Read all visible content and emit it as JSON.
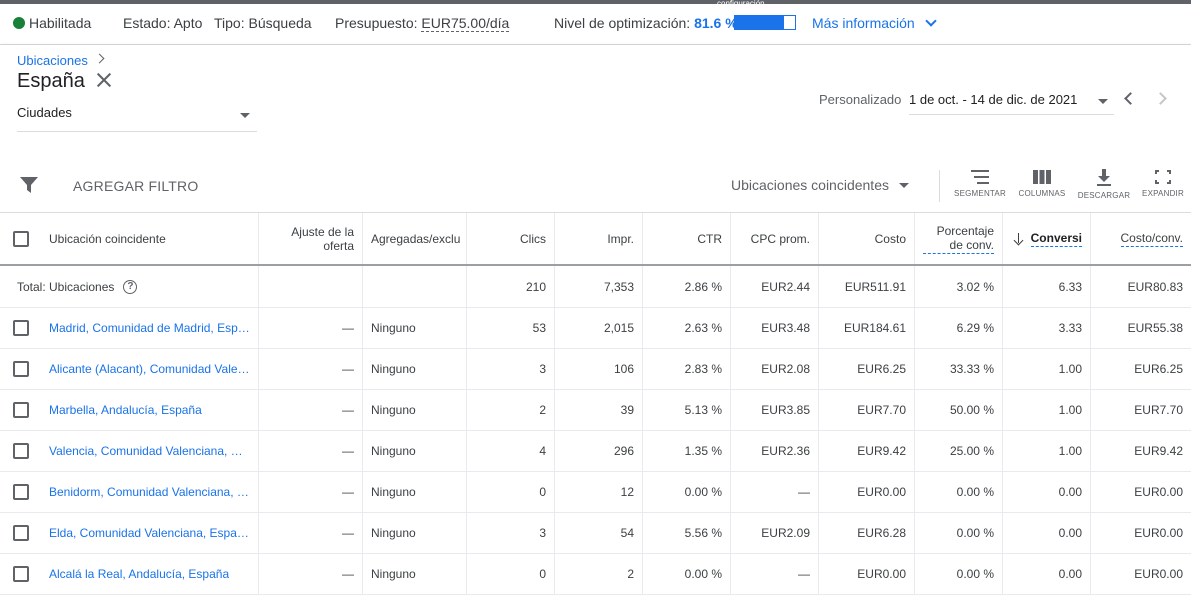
{
  "status_bar": {
    "status": "Habilitada",
    "estado": "Estado: Apto",
    "tipo": "Tipo: Búsqueda",
    "presupuesto_label": "Presupuesto:",
    "presupuesto_value": "EUR75.00/día",
    "optimization_label": "Nivel de optimización:",
    "optimization_value": "81.6 %",
    "optimization_fraction": 0.816,
    "more_info": "Más información",
    "tiny_label": "configuración",
    "status_color": "#188038",
    "accent_color": "#1a73e8"
  },
  "header": {
    "breadcrumb": "Ubicaciones",
    "title": "España",
    "city_select": "Ciudades",
    "date_label": "Personalizado",
    "date_range": "1 de oct. - 14 de dic. de 2021"
  },
  "toolbar": {
    "add_filter": "AGREGAR FILTRO",
    "match_select": "Ubicaciones coincidentes",
    "segment": "SEGMENTAR",
    "columns": "COLUMNAS",
    "download": "DESCARGAR",
    "expand": "EXPANDIR"
  },
  "table": {
    "columns": {
      "location": "Ubicación coincidente",
      "bid_adj": "Ajuste de la oferta",
      "added": "Agregadas/exclu",
      "clicks": "Clics",
      "impr": "Impr.",
      "ctr": "CTR",
      "cpc": "CPC prom.",
      "cost": "Costo",
      "conv_rate": "Porcentaje de conv.",
      "conversions": "Conversi",
      "cost_conv": "Costo/conv."
    },
    "total": {
      "label": "Total: Ubicaciones",
      "clicks": "210",
      "impr": "7,353",
      "ctr": "2.86 %",
      "cpc": "EUR2.44",
      "cost": "EUR511.91",
      "conv_rate": "3.02 %",
      "conversions": "6.33",
      "cost_conv": "EUR80.83"
    },
    "rows": [
      {
        "location": "Madrid, Comunidad de Madrid, Espa…",
        "bid_adj": "—",
        "added": "Ninguno",
        "clicks": "53",
        "impr": "2,015",
        "ctr": "2.63 %",
        "cpc": "EUR3.48",
        "cost": "EUR184.61",
        "conv_rate": "6.29 %",
        "conversions": "3.33",
        "cost_conv": "EUR55.38"
      },
      {
        "location": "Alicante (Alacant), Comunidad Vale…",
        "bid_adj": "—",
        "added": "Ninguno",
        "clicks": "3",
        "impr": "106",
        "ctr": "2.83 %",
        "cpc": "EUR2.08",
        "cost": "EUR6.25",
        "conv_rate": "33.33 %",
        "conversions": "1.00",
        "cost_conv": "EUR6.25"
      },
      {
        "location": "Marbella, Andalucía, España",
        "bid_adj": "—",
        "added": "Ninguno",
        "clicks": "2",
        "impr": "39",
        "ctr": "5.13 %",
        "cpc": "EUR3.85",
        "cost": "EUR7.70",
        "conv_rate": "50.00 %",
        "conversions": "1.00",
        "cost_conv": "EUR7.70"
      },
      {
        "location": "Valencia, Comunidad Valenciana, Es…",
        "bid_adj": "—",
        "added": "Ninguno",
        "clicks": "4",
        "impr": "296",
        "ctr": "1.35 %",
        "cpc": "EUR2.36",
        "cost": "EUR9.42",
        "conv_rate": "25.00 %",
        "conversions": "1.00",
        "cost_conv": "EUR9.42"
      },
      {
        "location": "Benidorm, Comunidad Valenciana, E…",
        "bid_adj": "—",
        "added": "Ninguno",
        "clicks": "0",
        "impr": "12",
        "ctr": "0.00 %",
        "cpc": "—",
        "cost": "EUR0.00",
        "conv_rate": "0.00 %",
        "conversions": "0.00",
        "cost_conv": "EUR0.00"
      },
      {
        "location": "Elda, Comunidad Valenciana, España",
        "bid_adj": "—",
        "added": "Ninguno",
        "clicks": "3",
        "impr": "54",
        "ctr": "5.56 %",
        "cpc": "EUR2.09",
        "cost": "EUR6.28",
        "conv_rate": "0.00 %",
        "conversions": "0.00",
        "cost_conv": "EUR0.00"
      },
      {
        "location": "Alcalá la Real, Andalucía, España",
        "bid_adj": "—",
        "added": "Ninguno",
        "clicks": "0",
        "impr": "2",
        "ctr": "0.00 %",
        "cpc": "—",
        "cost": "EUR0.00",
        "conv_rate": "0.00 %",
        "conversions": "0.00",
        "cost_conv": "EUR0.00"
      }
    ]
  }
}
